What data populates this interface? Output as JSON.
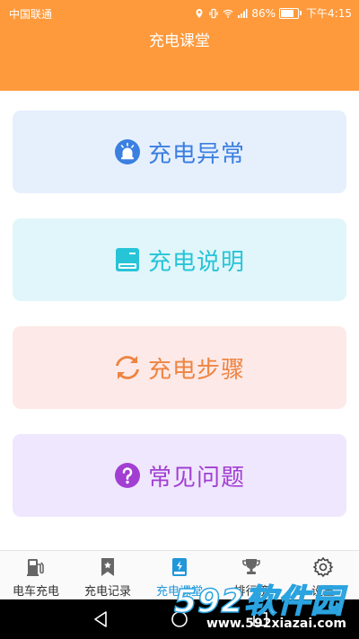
{
  "status_bar": {
    "carrier": "中国联通",
    "battery": "86%",
    "time": "下午4:15"
  },
  "header": {
    "title": "充电课堂"
  },
  "cards": [
    {
      "label": "充电异常",
      "icon": "alarm-icon",
      "bg": "#e6f0fd",
      "color": "#3b7fe0"
    },
    {
      "label": "充电说明",
      "icon": "book-icon",
      "bg": "#e1f6fa",
      "color": "#27c4d8"
    },
    {
      "label": "充电步骤",
      "icon": "refresh-icon",
      "bg": "#fde9e7",
      "color": "#ee8442"
    },
    {
      "label": "常见问题",
      "icon": "question-icon",
      "bg": "#efe7fd",
      "color": "#a23fd2"
    }
  ],
  "tabs": [
    {
      "label": "电车充电",
      "icon": "charging-station-icon"
    },
    {
      "label": "充电记录",
      "icon": "bookmark-icon"
    },
    {
      "label": "充电课堂",
      "icon": "book-icon",
      "active": true
    },
    {
      "label": "排行榜",
      "icon": "trophy-icon"
    },
    {
      "label": "设置",
      "icon": "gear-icon"
    }
  ],
  "watermark": {
    "main": "592软件园",
    "url": "www.592xiazai.com"
  }
}
